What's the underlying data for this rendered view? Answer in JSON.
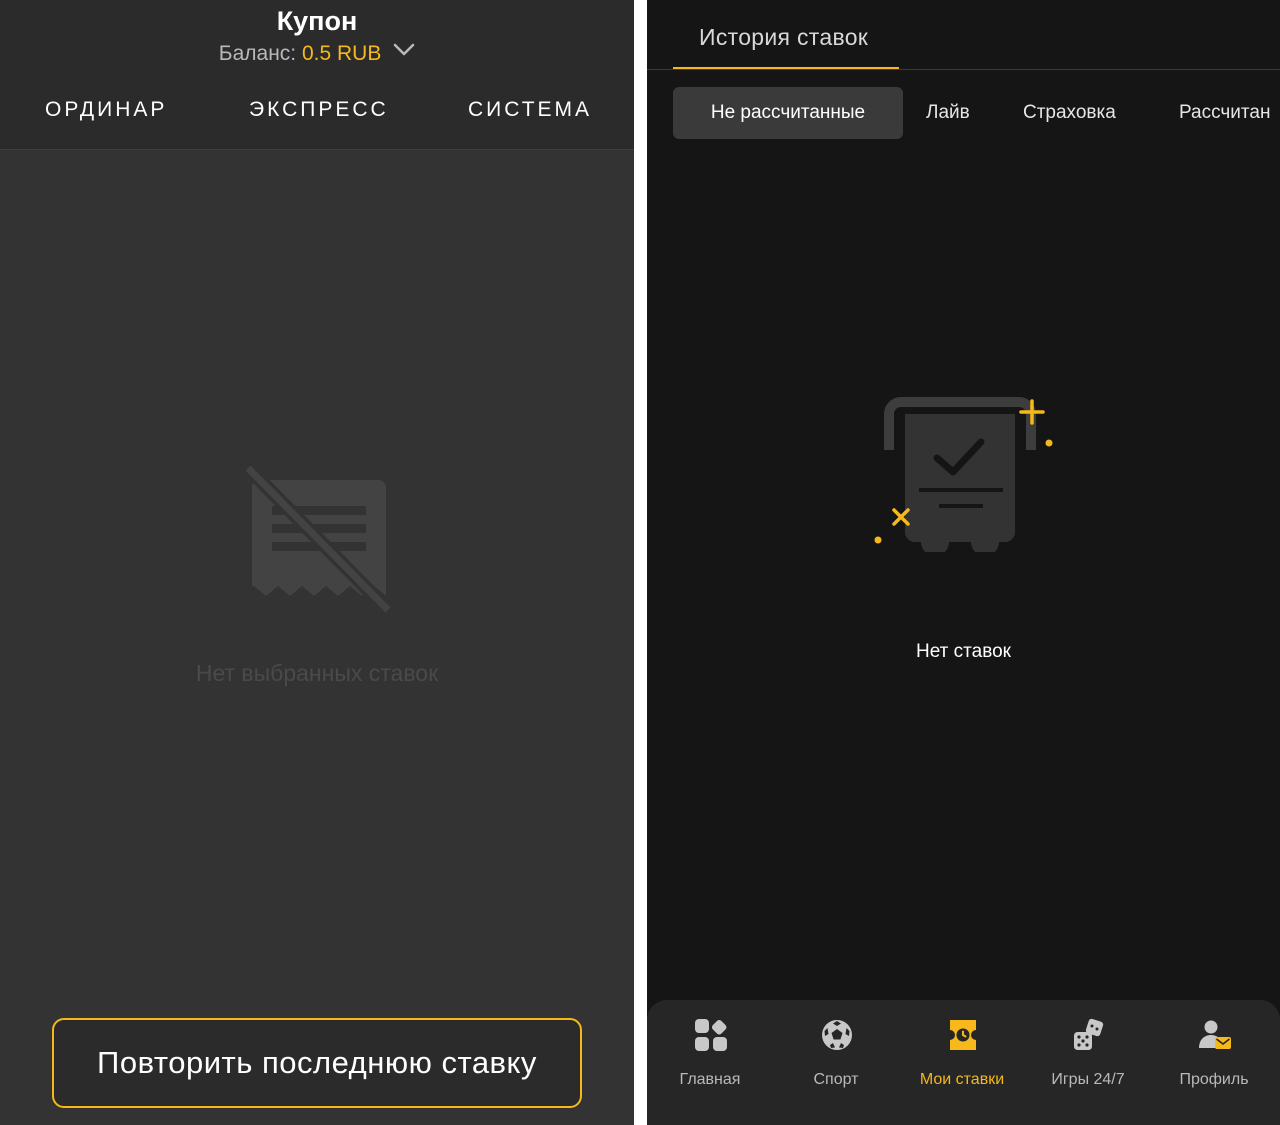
{
  "coupon": {
    "title": "Купон",
    "balance_label": "Баланс:",
    "balance_value": "0.5 RUB",
    "tabs": [
      "ОРДИНАР",
      "ЭКСПРЕСС",
      "СИСТЕМА"
    ],
    "empty_text": "Нет выбранных ставок",
    "repeat_button": "Повторить последнюю ставку"
  },
  "history": {
    "tab_title": "История ставок",
    "filters": [
      "Не рассчитанные",
      "Лайв",
      "Страховка",
      "Рассчитан"
    ],
    "active_filter_index": 0,
    "empty_text": "Нет ставок"
  },
  "bottom_nav": {
    "items": [
      {
        "label": "Главная",
        "icon": "grid-icon"
      },
      {
        "label": "Спорт",
        "icon": "soccer-ball-icon"
      },
      {
        "label": "Мои ставки",
        "icon": "ticket-icon"
      },
      {
        "label": "Игры 24/7",
        "icon": "dice-icon"
      },
      {
        "label": "Профиль",
        "icon": "profile-icon"
      }
    ],
    "active_index": 2
  },
  "colors": {
    "accent": "#f6b81a",
    "left_background": "#333333",
    "right_background": "#151515"
  }
}
